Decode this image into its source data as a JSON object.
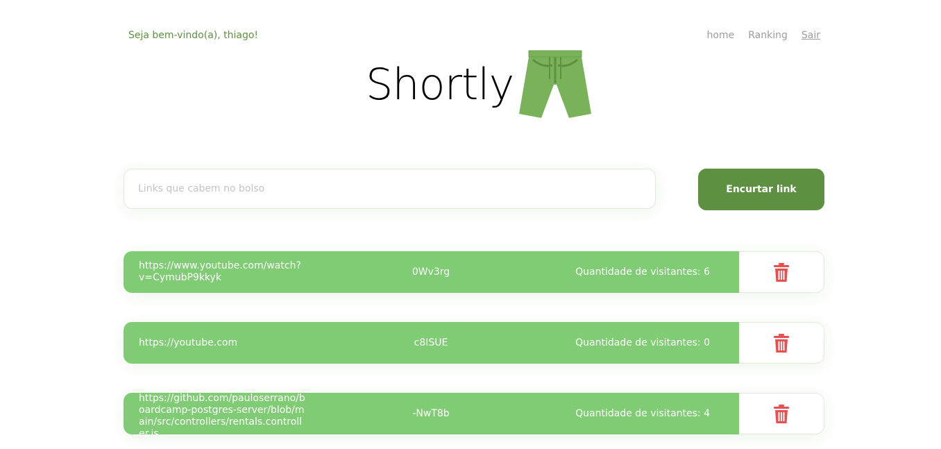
{
  "header": {
    "welcome": "Seja bem-vindo(a), thiago!",
    "nav": {
      "home": "home",
      "ranking": "Ranking",
      "logout": "Sair"
    }
  },
  "brand": {
    "name": "Shortly",
    "logo_icon": "shorts-icon",
    "logo_color": "#7ab259"
  },
  "shorten": {
    "placeholder": "Links que cabem no bolso",
    "value": "",
    "button_label": "Encurtar link"
  },
  "links": [
    {
      "url": "https://www.youtube.com/watch?v=CymubP9kkyk",
      "short": "0Wv3rg",
      "visits": "Quantidade de visitantes: 6"
    },
    {
      "url": "https://youtube.com",
      "short": "c8ISUE",
      "visits": "Quantidade de visitantes: 0"
    },
    {
      "url": "https://github.com/pauloserrano/boardcamp-postgres-server/blob/main/src/controllers/rentals.controller.js",
      "short": "-NwT8b",
      "visits": "Quantidade de visitantes: 4"
    }
  ],
  "colors": {
    "accent": "#5d9040",
    "row_background": "#80cc74",
    "delete_icon": "#ea4f4f"
  },
  "icons": {
    "delete": "trash-icon"
  }
}
